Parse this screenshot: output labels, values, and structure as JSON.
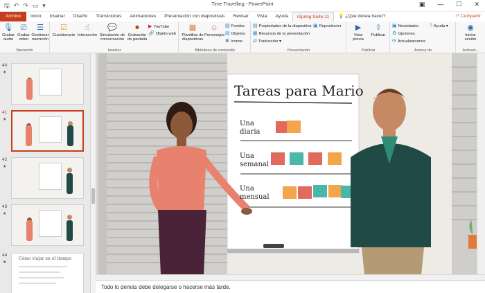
{
  "window": {
    "title": "Time Travelling - PowerPoint",
    "qat_icons": [
      "save-icon",
      "undo-icon",
      "redo-icon",
      "present-icon",
      "customize-icon"
    ],
    "controls": [
      "minimize-icon",
      "restore-icon",
      "close-icon"
    ]
  },
  "tabs": [
    {
      "label": "Archivo",
      "kind": "file"
    },
    {
      "label": "Inicio"
    },
    {
      "label": "Insertar"
    },
    {
      "label": "Diseño"
    },
    {
      "label": "Transiciones"
    },
    {
      "label": "Animaciones"
    },
    {
      "label": "Presentación con diapositivas"
    },
    {
      "label": "Revisar"
    },
    {
      "label": "Vista"
    },
    {
      "label": "Ayuda"
    },
    {
      "label": "iSpring Suite 11",
      "kind": "active"
    },
    {
      "label": "¿Qué desea hacer?",
      "kind": "search"
    }
  ],
  "share_label": "Compartir",
  "ribbon": {
    "narracion": {
      "label": "Narración",
      "buttons": [
        {
          "label": "Grabar audio",
          "icon": "microphone-icon"
        },
        {
          "label": "Grabar video",
          "icon": "video-camera-icon"
        },
        {
          "label": "Gestionar narración",
          "icon": "timeline-icon"
        }
      ]
    },
    "insertar": {
      "label": "Insertar",
      "buttons": [
        {
          "label": "Cuestionario",
          "icon": "quiz-icon"
        },
        {
          "label": "Interacción",
          "icon": "interaction-icon"
        },
        {
          "label": "Simulación de conversación",
          "icon": "dialog-icon"
        },
        {
          "label": "Grabación de pantalla",
          "icon": "screen-record-icon"
        }
      ],
      "small": [
        {
          "label": "YouTube",
          "icon": "youtube-icon"
        },
        {
          "label": "Objeto web",
          "icon": "web-object-icon"
        }
      ]
    },
    "biblioteca": {
      "label": "Biblioteca de contenido",
      "buttons": [
        {
          "label": "Plantillas de diapositivas",
          "icon": "templates-icon"
        },
        {
          "label": "Personajes",
          "icon": "character-icon"
        }
      ],
      "small": [
        {
          "label": "Fondos",
          "icon": "backgrounds-icon"
        },
        {
          "label": "Objetos",
          "icon": "objects-icon"
        },
        {
          "label": "Iconos",
          "icon": "icons-icon"
        }
      ]
    },
    "presentacion": {
      "label": "Presentación",
      "small": [
        {
          "label": "Propiedades de la diapositiva",
          "icon": "slide-properties-icon"
        },
        {
          "label": "Recursos de la presentación",
          "icon": "resources-icon"
        },
        {
          "label": "Traducción",
          "icon": "translation-icon"
        },
        {
          "label": "Reproductor",
          "icon": "player-icon"
        }
      ]
    },
    "publicar": {
      "label": "Publicar",
      "buttons": [
        {
          "label": "Vista previa",
          "icon": "preview-icon"
        },
        {
          "label": "Publicar",
          "icon": "publish-icon"
        }
      ]
    },
    "acerca": {
      "label": "Acerca de",
      "small": [
        {
          "label": "Novedades",
          "icon": "news-icon"
        },
        {
          "label": "Opciones",
          "icon": "options-icon"
        },
        {
          "label": "Actualizaciones",
          "icon": "updates-icon"
        },
        {
          "label": "Ayuda",
          "icon": "help-icon"
        }
      ]
    },
    "activacion": {
      "label": "Activaci...",
      "buttons": [
        {
          "label": "Iniciar sesión",
          "icon": "user-icon"
        }
      ]
    }
  },
  "slides": [
    {
      "number": "40"
    },
    {
      "number": "41",
      "selected": true
    },
    {
      "number": "42"
    },
    {
      "number": "43"
    },
    {
      "number": "44",
      "title": "Cómo viajar en el tiempo"
    }
  ],
  "slide": {
    "board_title": "Tareas para Mario",
    "rows": [
      {
        "label": "Una diaria"
      },
      {
        "label": "Una semanal"
      },
      {
        "label": "Una mensual"
      }
    ],
    "colors": {
      "woman_top": "#e8816d",
      "woman_pants": "#4a2338",
      "man_sweater": "#1f4a46",
      "man_shirt": "#2f8b7a",
      "man_pants": "#b59a76",
      "sticky_red": "#e26a5c",
      "sticky_teal": "#47b8a9",
      "sticky_orange": "#f2a54a"
    }
  },
  "notes_text": "Todo lo demás debe delegarse o hacerse más tarde."
}
